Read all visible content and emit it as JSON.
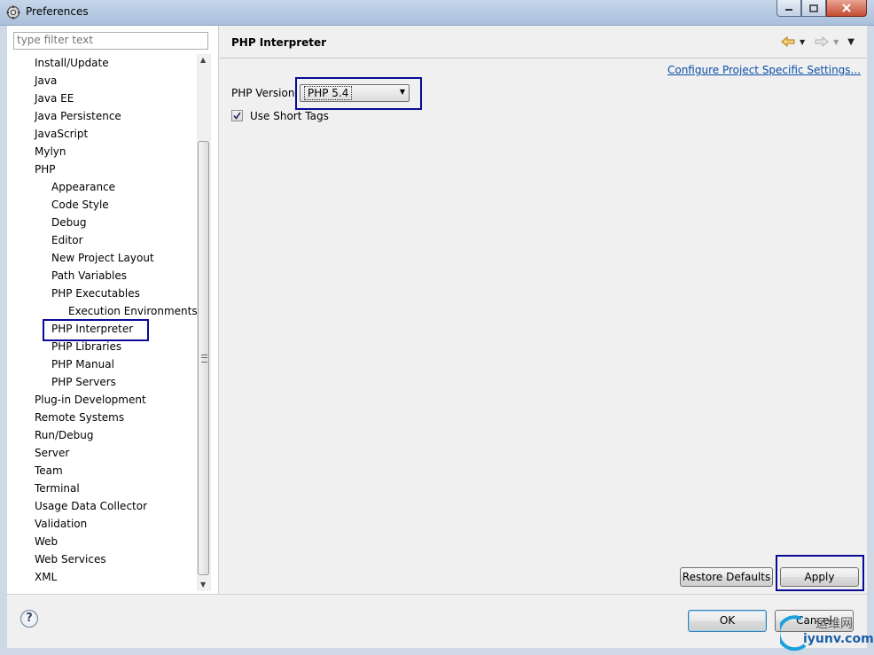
{
  "window": {
    "title": "Preferences"
  },
  "filter": {
    "placeholder": "type filter text"
  },
  "tree": {
    "items": [
      {
        "label": "Install/Update",
        "level": 0
      },
      {
        "label": "Java",
        "level": 0
      },
      {
        "label": "Java EE",
        "level": 0
      },
      {
        "label": "Java Persistence",
        "level": 0
      },
      {
        "label": "JavaScript",
        "level": 0
      },
      {
        "label": "Mylyn",
        "level": 0
      },
      {
        "label": "PHP",
        "level": 0
      },
      {
        "label": "Appearance",
        "level": 1
      },
      {
        "label": "Code Style",
        "level": 1
      },
      {
        "label": "Debug",
        "level": 1
      },
      {
        "label": "Editor",
        "level": 1
      },
      {
        "label": "New Project Layout",
        "level": 1
      },
      {
        "label": "Path Variables",
        "level": 1
      },
      {
        "label": "PHP Executables",
        "level": 1
      },
      {
        "label": "Execution Environments",
        "level": 2
      },
      {
        "label": "PHP Interpreter",
        "level": 1,
        "selected": true
      },
      {
        "label": "PHP Libraries",
        "level": 1
      },
      {
        "label": "PHP Manual",
        "level": 1
      },
      {
        "label": "PHP Servers",
        "level": 1
      },
      {
        "label": "Plug-in Development",
        "level": 0
      },
      {
        "label": "Remote Systems",
        "level": 0
      },
      {
        "label": "Run/Debug",
        "level": 0
      },
      {
        "label": "Server",
        "level": 0
      },
      {
        "label": "Team",
        "level": 0
      },
      {
        "label": "Terminal",
        "level": 0
      },
      {
        "label": "Usage Data Collector",
        "level": 0
      },
      {
        "label": "Validation",
        "level": 0
      },
      {
        "label": "Web",
        "level": 0
      },
      {
        "label": "Web Services",
        "level": 0
      },
      {
        "label": "XML",
        "level": 0
      }
    ]
  },
  "page": {
    "title": "PHP Interpreter",
    "configure_link": "Configure Project Specific Settings...",
    "php_version_label": "PHP Version",
    "php_version_value": "PHP 5.4",
    "short_tags_label": "Use Short Tags",
    "short_tags_checked": true
  },
  "buttons": {
    "restore_defaults": "Restore Defaults",
    "apply": "Apply",
    "ok": "OK",
    "cancel": "Cancel",
    "help": "?"
  },
  "watermark": {
    "line1": "运维网",
    "line2": "iyunv.com"
  },
  "colors": {
    "highlight_box": "#0a0a96",
    "link": "#0a4fa8"
  }
}
